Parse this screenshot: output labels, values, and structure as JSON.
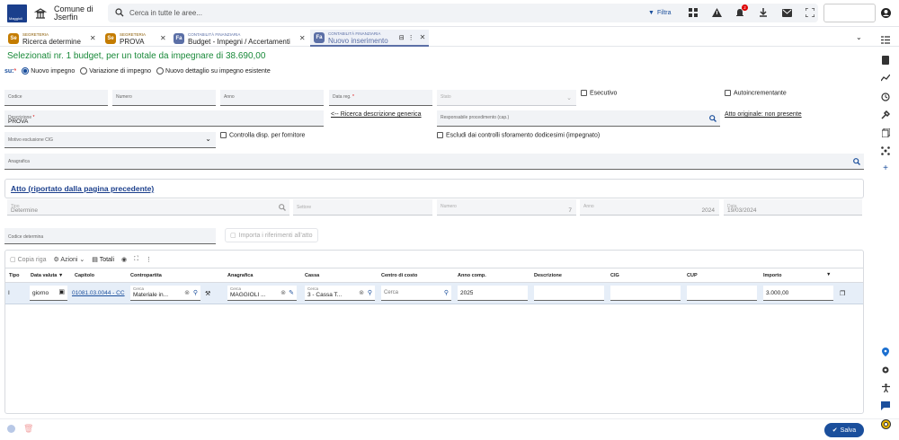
{
  "header": {
    "logo_text": "Maggioli",
    "org_line1": "Comune di",
    "org_line2": "Jserfin",
    "search_placeholder": "Cerca in tutte le aree...",
    "filter_label": "Filtra",
    "notification_count": "2"
  },
  "tabs": [
    {
      "section": "SEGRETERIA",
      "label": "Ricerca determine",
      "badge": "Se",
      "color": "#c47c00"
    },
    {
      "section": "SEGRETERIA",
      "label": "PROVA",
      "badge": "Se",
      "color": "#c47c00"
    },
    {
      "section": "CONTABILITÀ FINANZIARIA",
      "label": "Budget - Impegni / Accertamenti",
      "badge": "Fa",
      "color": "#5b6fa6"
    },
    {
      "section": "CONTABILITÀ FINANZIARIA",
      "label": "Nuovo inserimento",
      "badge": "Fa",
      "color": "#5b6fa6"
    }
  ],
  "page": {
    "heading": "Selezionati nr. 1 budget, per un totale da impegnare di 38.690,00",
    "su_label": "su:",
    "radios": [
      {
        "label": "Nuovo impegno",
        "selected": true
      },
      {
        "label": "Variazione di impegno",
        "selected": false
      },
      {
        "label": "Nuovo dettaglio su impegno esistente",
        "selected": false
      }
    ]
  },
  "form": {
    "codice": "Codice",
    "numero": "Numero",
    "anno": "Anno",
    "data_reg": "Data reg.",
    "stato": "Stato",
    "esecutivo": "Esecutivo",
    "autoincrementante": "Autoincrementante",
    "descrizione_label": "Descrizione",
    "descrizione_value": "PROVA",
    "ricerca_descrizione": "<-- Ricerca descrizione generica",
    "responsabile": "Responsabile procedimento (cap.)",
    "atto_originale": "Atto originale: non presente",
    "motivo_cig": "Motivo esclusione CIG",
    "controlla_disp": "Controlla disp. per fornitore",
    "escludi_controlli": "Escludi dai controlli sforamento dodicesimi (impegnato)",
    "anagrafica": "Anagrafica"
  },
  "atto": {
    "title": "Atto (riportato dalla pagina precedente)",
    "tipo_label": "Tipo",
    "tipo_value": "Determine",
    "settore": "Settore",
    "numero_label": "Numero",
    "numero_value": "7",
    "anno_label": "Anno",
    "anno_value": "2024",
    "data_label": "Data",
    "data_value": "19/03/2024",
    "codice_determina": "Codice determina",
    "importa": "Importa i riferimenti all'atto"
  },
  "grid": {
    "toolbar": {
      "copia": "Copia riga",
      "azioni": "Azioni",
      "totali": "Totali"
    },
    "columns": [
      "Tipo",
      "Data valuta",
      "Capitolo",
      "Contropartita",
      "Anagrafica",
      "Cassa",
      "Centro di costo",
      "Anno comp.",
      "Descrizione",
      "CIG",
      "CUP",
      "Importo"
    ],
    "row": {
      "tipo": "I",
      "data_valuta": "giorno",
      "capitolo": "01081.03.0044 - CC",
      "cerca": "Cerca",
      "contropartita": "Materiale in...",
      "anagrafica": "MAGGIOLI ...",
      "cassa": "3 - Cassa T...",
      "centro_costo": "Cerca",
      "anno_comp": "2025",
      "importo": "3.000,00"
    }
  },
  "footer": {
    "salva": "Salva"
  }
}
